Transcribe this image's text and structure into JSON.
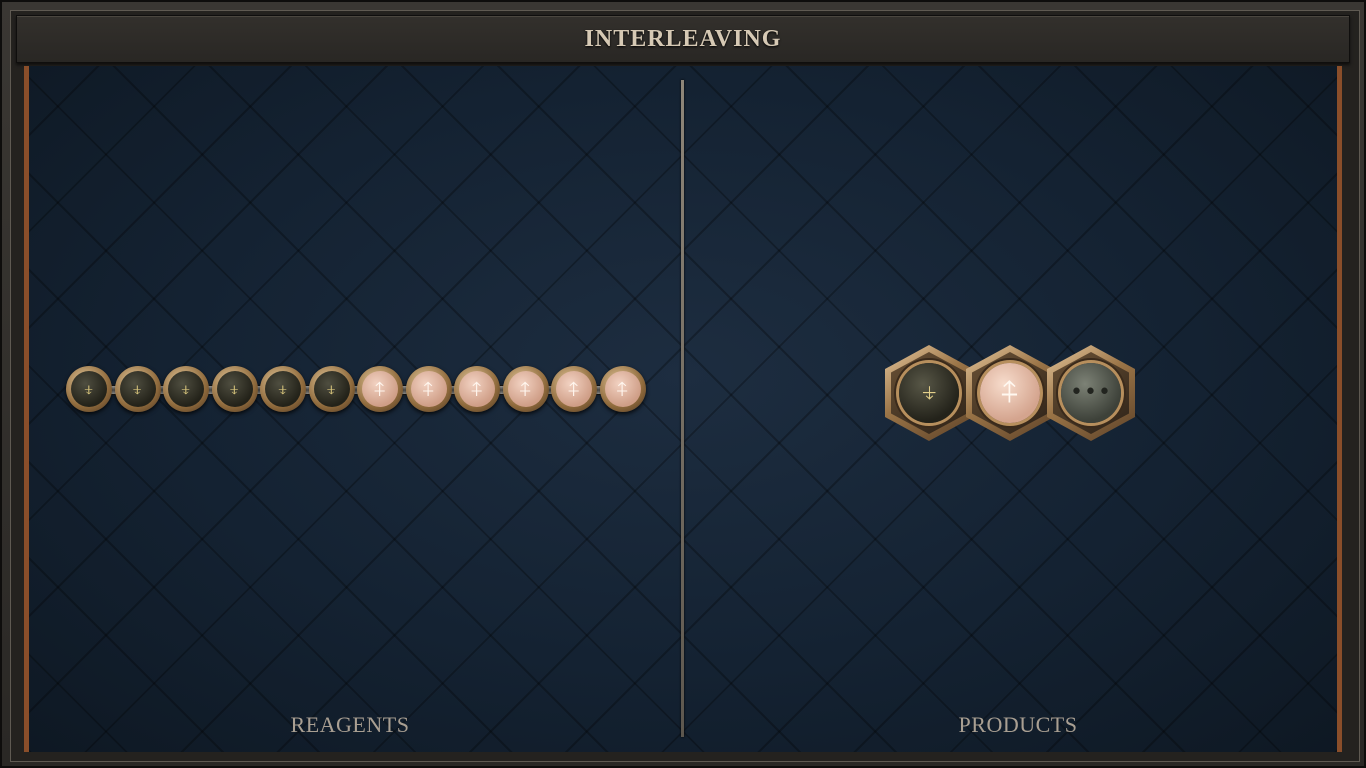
{
  "header": {
    "title": "INTERLEAVING"
  },
  "panels": {
    "left_label": "REAGENTS",
    "right_label": "PRODUCTS"
  },
  "reagents": [
    {
      "type": "down-glyph",
      "tone": "dark",
      "glyph": "⍖"
    },
    {
      "type": "down-glyph",
      "tone": "dark",
      "glyph": "⍖"
    },
    {
      "type": "down-glyph",
      "tone": "dark",
      "glyph": "⍖"
    },
    {
      "type": "down-glyph",
      "tone": "dark",
      "glyph": "⍖"
    },
    {
      "type": "down-glyph",
      "tone": "dark",
      "glyph": "⍖"
    },
    {
      "type": "down-glyph",
      "tone": "dark",
      "glyph": "⍖"
    },
    {
      "type": "up-glyph",
      "tone": "light",
      "glyph": "⍏"
    },
    {
      "type": "up-glyph",
      "tone": "light",
      "glyph": "⍏"
    },
    {
      "type": "up-glyph",
      "tone": "light",
      "glyph": "⍏"
    },
    {
      "type": "up-glyph",
      "tone": "light",
      "glyph": "⍏"
    },
    {
      "type": "up-glyph",
      "tone": "light",
      "glyph": "⍏"
    },
    {
      "type": "up-glyph",
      "tone": "light",
      "glyph": "⍏"
    }
  ],
  "products": [
    {
      "type": "down-glyph",
      "tone": "dark",
      "glyph": "⍖"
    },
    {
      "type": "up-glyph",
      "tone": "light",
      "glyph": "⍏"
    },
    {
      "type": "ellipsis",
      "tone": "grey",
      "glyph": "•••"
    }
  ],
  "colors": {
    "board": "#142130",
    "rim": "#8a4e2a",
    "title": "#d6c9b4",
    "label": "#a99f92"
  }
}
